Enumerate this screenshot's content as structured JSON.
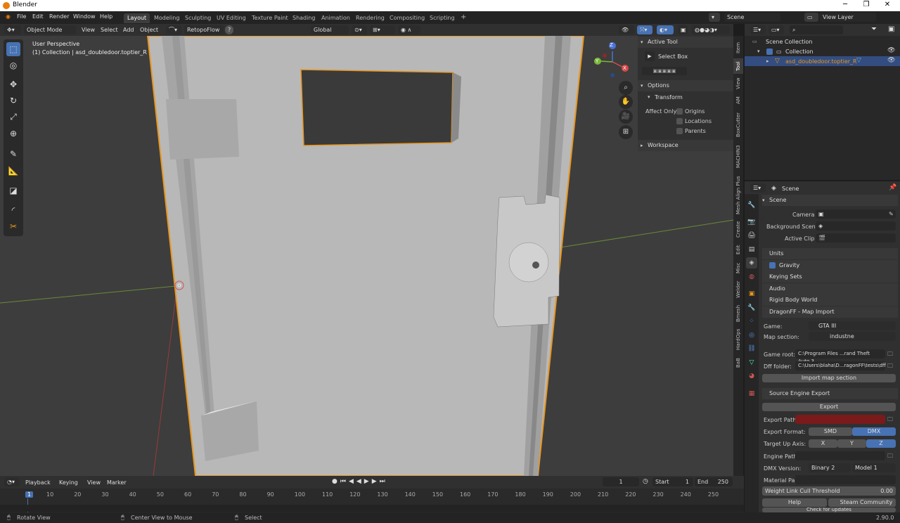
{
  "window": {
    "title": "Blender"
  },
  "menu": [
    "File",
    "Edit",
    "Render",
    "Window",
    "Help"
  ],
  "workspaces": [
    "Layout",
    "Modeling",
    "Sculpting",
    "UV Editing",
    "Texture Paint",
    "Shading",
    "Animation",
    "Rendering",
    "Compositing",
    "Scripting"
  ],
  "scene_field": "Scene",
  "view_layer_field": "View Layer",
  "viewport_header": {
    "mode": "Object Mode",
    "menus": [
      "View",
      "Select",
      "Add",
      "Object"
    ],
    "addon": "RetopoFlow",
    "orientation": "Global"
  },
  "viewport": {
    "perspective": "User Perspective",
    "collection_info": "(1) Collection | asd_doubledoor.toptier_R",
    "gizmo": {
      "x": "X",
      "y": "Y",
      "z": "Z"
    }
  },
  "npanel": {
    "active_tool_header": "Active Tool",
    "tool_name": "Select Box",
    "options_header": "Options",
    "transform_header": "Transform",
    "affect_only_label": "Affect Only",
    "affect_items": [
      "Origins",
      "Locations",
      "Parents"
    ],
    "workspace_header": "Workspace",
    "tabs": [
      "Item",
      "Tool",
      "View",
      "AM",
      "BoxCutter",
      "MACHIN3",
      "Mesh Align Plus",
      "Create",
      "Edit",
      "Misc",
      "Welder",
      "Bmesh",
      "HardOps",
      "BaB"
    ]
  },
  "outliner": {
    "root": "Scene Collection",
    "collection": "Collection",
    "object": "asd_doubledoor.toptier_R"
  },
  "properties": {
    "context": "Scene",
    "scene_header": "Scene",
    "camera_label": "Camera",
    "bg_scene_label": "Background Scene",
    "active_clip_label": "Active Clip",
    "units": "Units",
    "gravity": "Gravity",
    "keying_sets": "Keying Sets",
    "audio": "Audio",
    "rigid_body": "Rigid Body World",
    "dragonff": "DragonFF - Map Import",
    "game_label": "Game:",
    "game_value": "GTA III",
    "map_section_label": "Map section:",
    "map_section_value": "industne",
    "game_root_label": "Game root:",
    "game_root_value": "C:\\Program Files ...rand Theft Auto 3",
    "dff_folder_label": "Dff folder:",
    "dff_folder_value": "C:\\Users\\blaha\\D...ragonFF\\tests\\dff",
    "import_btn": "Import map section",
    "source_engine": "Source Engine Export",
    "export_btn": "Export",
    "export_path_label": "Export Path:",
    "export_format_label": "Export Format:",
    "format_smd": "SMD",
    "format_dmx": "DMX",
    "target_up_label": "Target Up Axis:",
    "axis_x": "X",
    "axis_y": "Y",
    "axis_z": "Z",
    "engine_path_label": "Engine Path:",
    "dmx_version_label": "DMX Version:",
    "dmx_binary": "Binary 2",
    "dmx_model": "Model 1",
    "material_label": "Material Pa...",
    "weight_link_label": "Weight Link Cull Threshold",
    "weight_link_value": "0.00",
    "help_btn": "Help",
    "community_btn": "Steam Community",
    "check_updates": "Check for updates"
  },
  "timeline": {
    "menus": [
      "Playback",
      "Keying",
      "View",
      "Marker"
    ],
    "current_frame": "1",
    "start_label": "Start",
    "start_value": "1",
    "end_label": "End",
    "end_value": "250",
    "ruler": [
      "1",
      "10",
      "20",
      "30",
      "40",
      "50",
      "60",
      "70",
      "80",
      "90",
      "100",
      "110",
      "120",
      "130",
      "140",
      "150",
      "160",
      "170",
      "180",
      "190",
      "200",
      "210",
      "220",
      "230",
      "240",
      "250"
    ]
  },
  "status": {
    "rotate": "Rotate View",
    "center": "Center View to Mouse",
    "select": "Select",
    "version": "2.90.0"
  },
  "colors": {
    "accent": "#4772b3",
    "selection": "#e8961e",
    "export_path": "#7a1a1a"
  }
}
